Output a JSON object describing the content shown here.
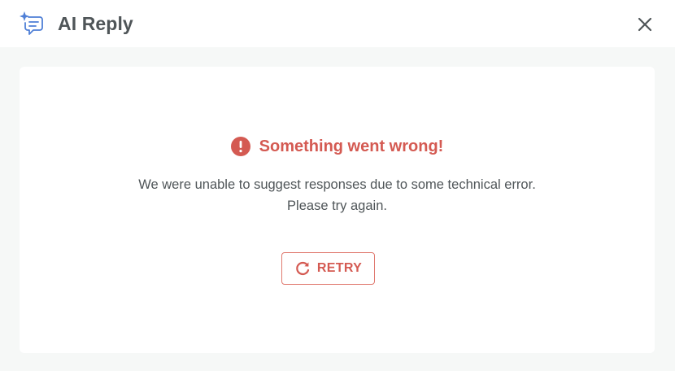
{
  "header": {
    "title": "AI Reply",
    "icon": "ai-chat-sparkle-icon",
    "close_icon": "close-icon"
  },
  "error": {
    "title": "Something went wrong!",
    "icon": "exclamation-circle-icon",
    "message_line1": "We were unable to suggest responses due to some technical error.",
    "message_line2": "Please try again."
  },
  "retry": {
    "label": "RETRY",
    "icon": "refresh-icon"
  },
  "colors": {
    "accent_blue": "#4f7fd6",
    "error_red": "#d45a52",
    "button_border": "#e07a70",
    "text_gray": "#4f5558",
    "background": "#f6f8f7"
  }
}
